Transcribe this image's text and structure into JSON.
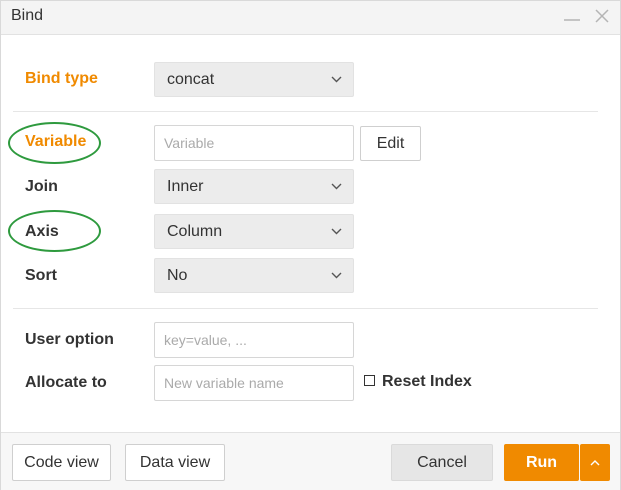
{
  "window": {
    "title": "Bind",
    "colors": {
      "accent": "#f08a00",
      "run_button": "#f08a00",
      "highlight_ellipse": "#2e9a3e"
    }
  },
  "form": {
    "bind_type": {
      "label": "Bind type",
      "value": "concat"
    },
    "variable": {
      "label": "Variable",
      "placeholder": "Variable",
      "value": "",
      "edit_label": "Edit"
    },
    "join": {
      "label": "Join",
      "value": "Inner"
    },
    "axis": {
      "label": "Axis",
      "value": "Column"
    },
    "sort": {
      "label": "Sort",
      "value": "No"
    },
    "user_option": {
      "label": "User option",
      "placeholder": "key=value, ...",
      "value": ""
    },
    "allocate_to": {
      "label": "Allocate to",
      "placeholder": "New variable name",
      "value": ""
    },
    "reset_index": {
      "label": "Reset Index",
      "checked": false
    }
  },
  "footer": {
    "code_view_label": "Code view",
    "data_view_label": "Data view",
    "cancel_label": "Cancel",
    "run_label": "Run"
  }
}
